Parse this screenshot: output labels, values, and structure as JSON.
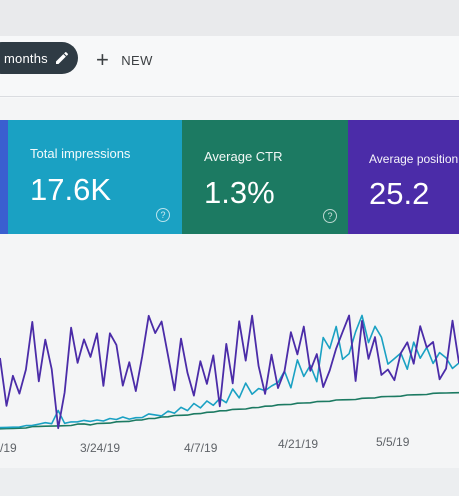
{
  "toolbar": {
    "range_chip_label": "months",
    "new_label": "NEW",
    "new_icon": "plus-icon",
    "edit_icon": "pencil-icon"
  },
  "metrics": [
    {
      "label": "Total impressions",
      "value": "17.6K",
      "color": "#1aa1c3",
      "help_icon": "help-circle-icon"
    },
    {
      "label": "Average CTR",
      "value": "1.3%",
      "color": "#1c7a62",
      "help_icon": "help-circle-icon"
    },
    {
      "label": "Average position",
      "value": "25.2",
      "color": "#4b2ca8"
    }
  ],
  "chart_data": {
    "type": "line",
    "title": "",
    "xlabel": "",
    "ylabel": "",
    "x_tick_labels": [
      "/19",
      "3/24/19",
      "4/7/19",
      "4/21/19",
      "5/5/19"
    ],
    "grid": false,
    "series": [
      {
        "color": "#4b2ca8",
        "values": [
          0.6,
          0.2,
          0.45,
          0.3,
          0.5,
          0.9,
          0.4,
          0.75,
          0.5,
          0.0,
          0.3,
          0.85,
          0.55,
          0.75,
          0.6,
          0.8,
          0.35,
          0.8,
          0.7,
          0.35,
          0.55,
          0.3,
          0.6,
          0.95,
          0.8,
          0.9,
          0.6,
          0.3,
          0.75,
          0.45,
          0.25,
          0.55,
          0.35,
          0.6,
          0.15,
          0.7,
          0.35,
          0.9,
          0.55,
          0.95,
          0.5,
          0.25,
          0.6,
          0.3,
          0.45,
          0.8,
          0.6,
          0.85,
          0.45,
          0.6,
          0.3,
          0.45,
          0.65,
          0.8,
          0.95,
          0.35,
          0.9,
          0.55,
          0.75,
          0.4,
          0.45,
          0.35,
          0.6,
          0.7,
          0.5,
          0.85,
          0.65,
          0.7,
          0.35,
          0.45,
          0.9,
          0.5
        ]
      },
      {
        "color": "#1aa1c3",
        "values": [
          0.02,
          0.02,
          0.02,
          0.02,
          0.03,
          0.03,
          0.04,
          0.05,
          0.04,
          0.15,
          0.04,
          0.05,
          0.05,
          0.06,
          0.05,
          0.06,
          0.05,
          0.07,
          0.06,
          0.08,
          0.06,
          0.07,
          0.07,
          0.1,
          0.09,
          0.08,
          0.12,
          0.1,
          0.15,
          0.12,
          0.18,
          0.14,
          0.2,
          0.16,
          0.22,
          0.18,
          0.3,
          0.22,
          0.35,
          0.25,
          0.3,
          0.28,
          0.32,
          0.35,
          0.45,
          0.3,
          0.55,
          0.4,
          0.5,
          0.35,
          0.75,
          0.65,
          0.85,
          0.55,
          0.6,
          0.8,
          0.95,
          0.7,
          0.85,
          0.75,
          0.5,
          0.55,
          0.6,
          0.45,
          0.7,
          0.55,
          0.65,
          0.5,
          0.6,
          0.55,
          0.45,
          0.5
        ]
      },
      {
        "color": "#1c7a62",
        "values": [
          0.01,
          0.01,
          0.01,
          0.01,
          0.01,
          0.02,
          0.02,
          0.02,
          0.02,
          0.02,
          0.02,
          0.02,
          0.03,
          0.03,
          0.02,
          0.03,
          0.03,
          0.03,
          0.04,
          0.04,
          0.04,
          0.05,
          0.05,
          0.06,
          0.06,
          0.07,
          0.07,
          0.08,
          0.08,
          0.08,
          0.09,
          0.09,
          0.1,
          0.1,
          0.11,
          0.11,
          0.12,
          0.12,
          0.12,
          0.13,
          0.13,
          0.14,
          0.14,
          0.15,
          0.15,
          0.15,
          0.16,
          0.16,
          0.16,
          0.17,
          0.17,
          0.17,
          0.18,
          0.18,
          0.18,
          0.18,
          0.19,
          0.19,
          0.19,
          0.2,
          0.2,
          0.2,
          0.2,
          0.21,
          0.21,
          0.21,
          0.21,
          0.22,
          0.22,
          0.22,
          0.22,
          0.22
        ]
      }
    ]
  }
}
